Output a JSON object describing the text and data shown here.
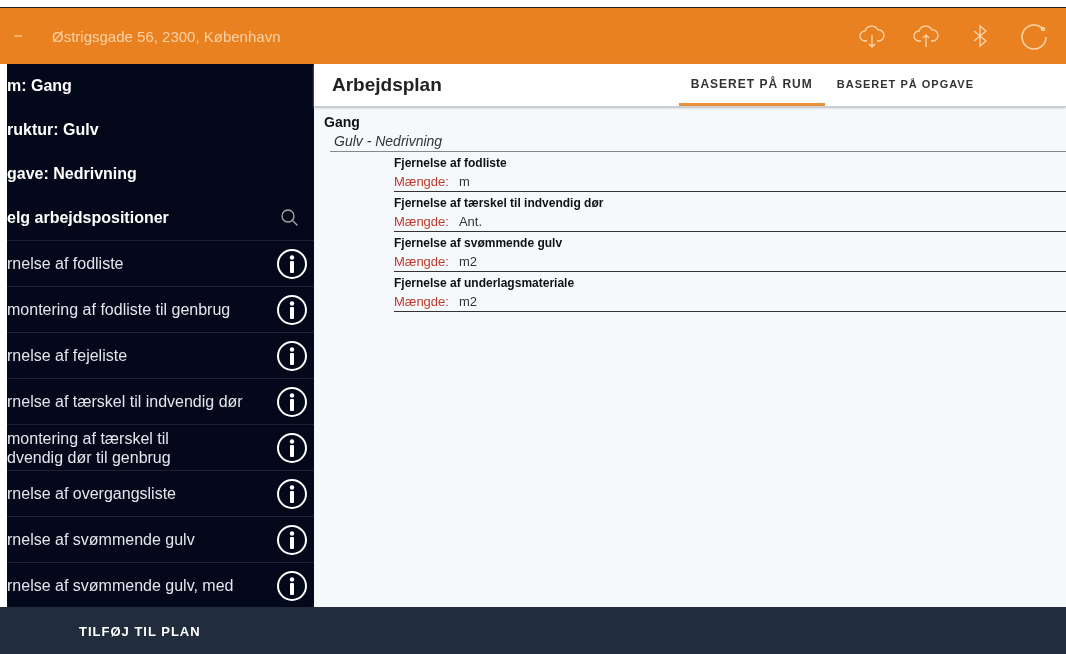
{
  "top_bar": {
    "address": "Østrigsgade 56, 2300, København"
  },
  "sidebar": {
    "headers": [
      "m: Gang",
      "ruktur: Gulv",
      "gave: Nedrivning"
    ],
    "search_label": "elg arbejdspositioner",
    "items": [
      {
        "label": "rnelse af fodliste"
      },
      {
        "label": "montering af fodliste til genbrug"
      },
      {
        "label": "rnelse af fejeliste"
      },
      {
        "label": "rnelse af tærskel til indvendig dør"
      },
      {
        "label": "montering af tærskel til\ndvendig dør til genbrug"
      },
      {
        "label": "rnelse af overgangsliste"
      },
      {
        "label": "rnelse af svømmende gulv"
      },
      {
        "label": "rnelse af svømmende gulv, med"
      }
    ]
  },
  "plan": {
    "title": "Arbejdsplan",
    "tabs": [
      {
        "label": "BASERET PÅ RUM",
        "selected": true
      },
      {
        "label": "BASERET PÅ OPGAVE",
        "selected": false
      }
    ],
    "room": "Gang",
    "group": "Gulv - Nedrivning",
    "items": [
      {
        "name": "Fjernelse af fodliste",
        "quantity_label": "Mængde:",
        "unit": "m"
      },
      {
        "name": "Fjernelse af tærskel til indvendig dør",
        "quantity_label": "Mængde:",
        "unit": "Ant."
      },
      {
        "name": "Fjernelse af svømmende gulv",
        "quantity_label": "Mængde:",
        "unit": "m2"
      },
      {
        "name": "Fjernelse af underlagsmateriale",
        "quantity_label": "Mængde:",
        "unit": "m2"
      }
    ]
  },
  "bottom_bar": {
    "button": "TILFØJ TIL PLAN"
  }
}
